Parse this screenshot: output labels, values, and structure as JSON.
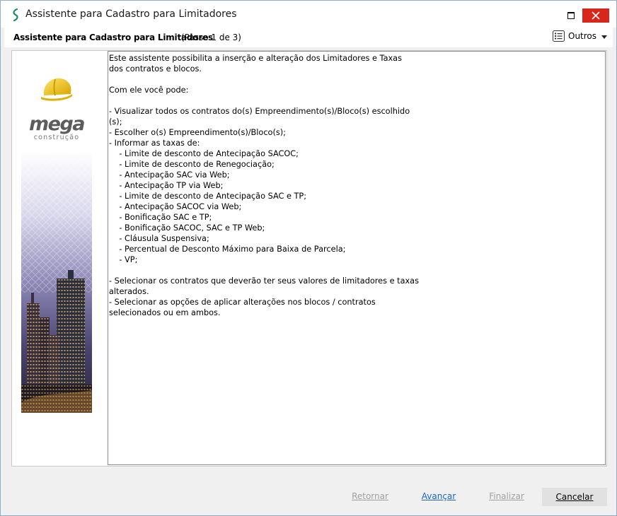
{
  "window": {
    "title": "Assistente para Cadastro para Limitadores"
  },
  "header": {
    "step_title": "Assistente para Cadastro para Limitadores",
    "step_counter": "(Passo 1 de 3)",
    "menu_label": "Outros"
  },
  "banner": {
    "brand": "mega",
    "brand_sub": "construção"
  },
  "description": "Este assistente possibilita a inserção e alteração dos Limitadores e Taxas\ndos contratos e blocos.\n\nCom ele você pode:\n\n- Visualizar todos os contratos do(s) Empreendimento(s)/Bloco(s) escolhido\n(s);\n- Escolher o(s) Empreendimento(s)/Bloco(s);\n- Informar as taxas de:\n    - Limite de desconto de Antecipação SACOC;\n    - Limite de desconto de Renegociação;\n    - Antecipação SAC via Web;\n    - Antecipação TP via Web;\n    - Limite de desconto de Antecipação SAC e TP;\n    - Antecipação SACOC via Web;\n    - Bonificação SAC e TP;\n    - Bonificação SACOC, SAC e TP Web;\n    - Cláusula Suspensiva;\n    - Percentual de Desconto Máximo para Baixa de Parcela;\n    - VP;\n\n- Selecionar os contratos que deverão ter seus valores de limitadores e taxas\nalterados.\n- Selecionar as opções de aplicar alterações nos blocos / contratos\nselecionados ou em ambos.",
  "footer": {
    "back_label": "Retornar",
    "next_label": "Avançar",
    "finish_label": "Finalizar",
    "cancel_label": "Cancelar"
  },
  "colors": {
    "close_button": "#d9261b",
    "link_active": "#1d64c8",
    "link_disabled": "#a0a0a0",
    "helmet": "#f2c300"
  }
}
